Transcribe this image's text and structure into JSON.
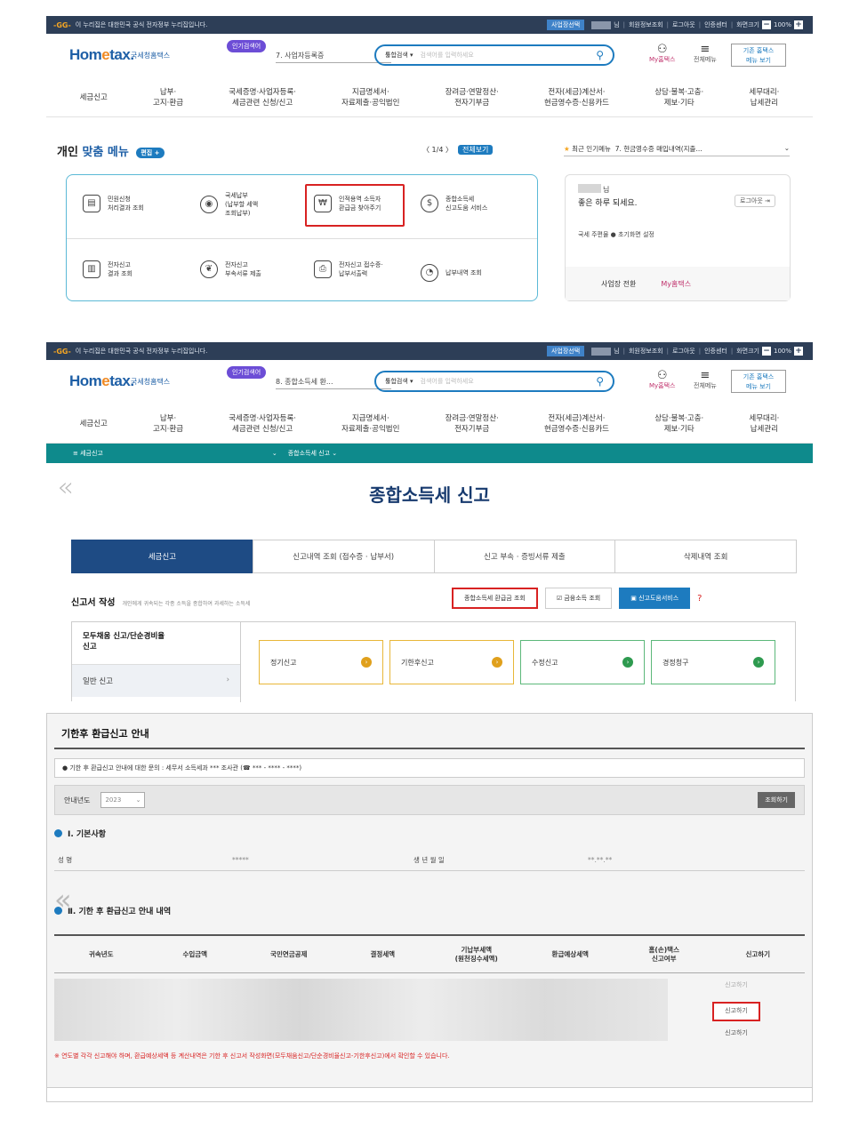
{
  "gov_banner": {
    "text": "이 누리집은 대한민국 공식 전자정부 누리집입니다.",
    "business_btn": "사업장선택",
    "user_suffix": "님",
    "links1": [
      "회원정보조회",
      "로그아웃",
      "인증센터",
      "화면크기"
    ],
    "links2": [
      "회원정보조회",
      "로그아웃",
      "인증센터",
      "화면크기"
    ],
    "zoom": "100%"
  },
  "header": {
    "logo_main": "Hom",
    "logo_e": "e",
    "logo_tail": "tax.",
    "logo_sub": "국세청홈택스",
    "popular_label": "인기검색어",
    "popular_keyword1": "7. 사업자등록증",
    "popular_keyword2": "8. 종합소득세 환...",
    "search_category": "통합검색 ▾",
    "search_placeholder": "검색어를 입력하세요",
    "my_hometax": "My홈택스",
    "all_menu": "전체메뉴",
    "basic_menu": "기존 홈택스\n메뉴 보기"
  },
  "gnb": [
    "세금신고",
    "납부·\n고지·환급",
    "국세증명·사업자등록·\n세금관련 신청/신고",
    "지급명세서·\n자료제출·공익법인",
    "장려금·연말정산·\n전자기부금",
    "전자(세금)계산서·\n현금영수증·신용카드",
    "상담·불복·고충·\n제보·기타",
    "세무대리·\n납세관리"
  ],
  "personal": {
    "title_a": "개인",
    "title_b": "맞춤 메뉴",
    "setting_btn": "편집 +",
    "pager": "〈 1/4 〉",
    "view_all": "전체보기",
    "popular_menu_label": "최근 인기메뉴",
    "popular_menu_value": "7. 현금영수증 매입내역(지출...",
    "items": [
      {
        "label": "민원신청\n처리결과 조회",
        "icon": "document-icon"
      },
      {
        "label": "국세납부\n(납부할 세액\n조회납부)",
        "icon": "coin-icon"
      },
      {
        "label": "인적용역 소득자\n환급금 찾아주기",
        "icon": "refund-icon"
      },
      {
        "label": "종합소득세\n신고도움 서비스",
        "icon": "moneybag-icon"
      },
      {
        "label": "전자신고\n결과 조회",
        "icon": "report-icon"
      },
      {
        "label": "전자신고\n부속서류 제출",
        "icon": "handshake-icon"
      },
      {
        "label": "전자신고 접수증·\n납부서출력",
        "icon": "printer-icon"
      },
      {
        "label": "납부내역 조회",
        "icon": "chart-icon"
      }
    ],
    "user_nim": "님",
    "greeting": "좋은 하루 되세요.",
    "logout": "로그아웃 ⇥",
    "links": "국세 주편물   ● 초기화면 설정",
    "switch_btn": "사업장 전환",
    "my_hometax": "My홈택스"
  },
  "navbar": {
    "left": "≡ 세금신고",
    "right": "종합소득세 신고 ⌄",
    "chev": "⌄"
  },
  "page": {
    "title": "종합소득세 신고",
    "tabs": [
      "세금신고",
      "신고내역 조회 (접수증 · 납부서)",
      "신고 부속 · 증빙서류 제출",
      "삭제내역 조회"
    ],
    "doc_title": "신고서 작성",
    "doc_sub": "개인에게 귀속되는 각종 소득을 종합하여 과세하는 소득세",
    "btn_refund": "종합소득세 환급금 조회",
    "btn_finance": "☑ 금융소득 조회",
    "btn_help": "▣ 신고도움서비스",
    "btn_q": "?",
    "left_a": "모두채움 신고/단순경비율\n신고",
    "left_b": "일반 신고",
    "boxes": [
      "정기신고",
      "기한후신고",
      "수정신고",
      "경정청구"
    ]
  },
  "refund": {
    "title": "기한후 환급신고 안내",
    "contact": "● 기한 후 환급신고 안내에 대한 문의 : 세무서 소득세과 *** 조사관 (☎ *** - **** - ****)",
    "year_label": "안내년도",
    "year_value": "2023",
    "search_btn": "조회하기",
    "sec1": "Ⅰ. 기본사항",
    "name_key": "성       명",
    "name_val": "*****",
    "birth_key": "생 년 월 일",
    "birth_val": "**.**.**",
    "sec2": "Ⅱ. 기한 후 환급신고 안내 내역",
    "columns": [
      "귀속년도",
      "수입금액",
      "국민연금공제",
      "결정세액",
      "기납부세액\n(원천징수세액)",
      "환급예상세액",
      "홈(손)택스\n신고여부",
      "신고하기"
    ],
    "actions": [
      "신고하기",
      "신고하기",
      "신고하기"
    ],
    "note": "※ 연도별 각각 신고해야 하며, 환급예상세액 등 계산내역은 기한 후 신고서 작성화면(모두채움신고/단순경비율신고-기한후신고)에서 확인할 수 있습니다."
  }
}
